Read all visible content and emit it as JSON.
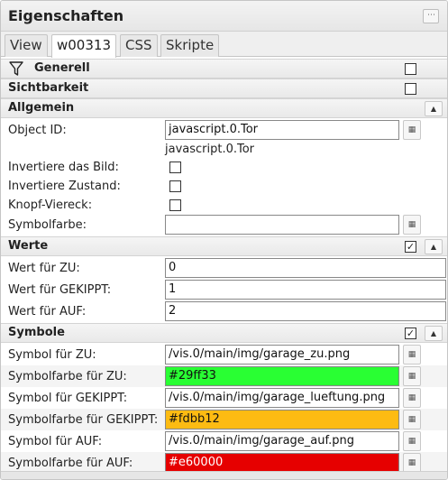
{
  "panel": {
    "title": "Eigenschaften"
  },
  "tabs": [
    {
      "label": "View"
    },
    {
      "label": "w00313"
    },
    {
      "label": "CSS"
    },
    {
      "label": "Skripte"
    }
  ],
  "sections": {
    "generell": {
      "title": "Generell",
      "checked": false
    },
    "sichtbarkeit": {
      "title": "Sichtbarkeit",
      "checked": false
    },
    "allgemein": {
      "title": "Allgemein"
    },
    "werte": {
      "title": "Werte",
      "checked": true
    },
    "symbole": {
      "title": "Symbole",
      "checked": true
    }
  },
  "allgemein": {
    "object_id_label": "Object ID:",
    "object_id_value": "javascript.0.Tor",
    "object_id_hint": "javascript.0.Tor",
    "invert_image_label": "Invertiere das Bild:",
    "invert_state_label": "Invertiere Zustand:",
    "button_square_label": "Knopf-Viereck:",
    "symbol_color_label": "Symbolfarbe:",
    "symbol_color_value": ""
  },
  "werte": {
    "zu_label": "Wert für ZU:",
    "zu_value": "0",
    "gekippt_label": "Wert für GEKIPPT:",
    "gekippt_value": "1",
    "auf_label": "Wert für AUF:",
    "auf_value": "2"
  },
  "symbole": {
    "symbol_zu_label": "Symbol für ZU:",
    "symbol_zu_value": "/vis.0/main/img/garage_zu.png",
    "color_zu_label": "Symbolfarbe für ZU:",
    "color_zu_value": "#29ff33",
    "symbol_gekippt_label": "Symbol für GEKIPPT:",
    "symbol_gekippt_value": "/vis.0/main/img/garage_lueftung.png",
    "color_gekippt_label": "Symbolfarbe für GEKIPPT:",
    "color_gekippt_value": "#fdbb12",
    "symbol_auf_label": "Symbol für AUF:",
    "symbol_auf_value": "/vis.0/main/img/garage_auf.png",
    "color_auf_label": "Symbolfarbe für AUF:",
    "color_auf_value": "#e60000"
  },
  "icons": {
    "panel_menu": "menu-dots-icon",
    "filter": "filter-icon",
    "collapse": "chevron-up-icon",
    "picker": "list-picker-icon",
    "check": "✓"
  },
  "colors": {
    "zu_swatch": "#29ff33",
    "gekippt_swatch": "#fdbb12",
    "auf_swatch": "#e60000"
  }
}
